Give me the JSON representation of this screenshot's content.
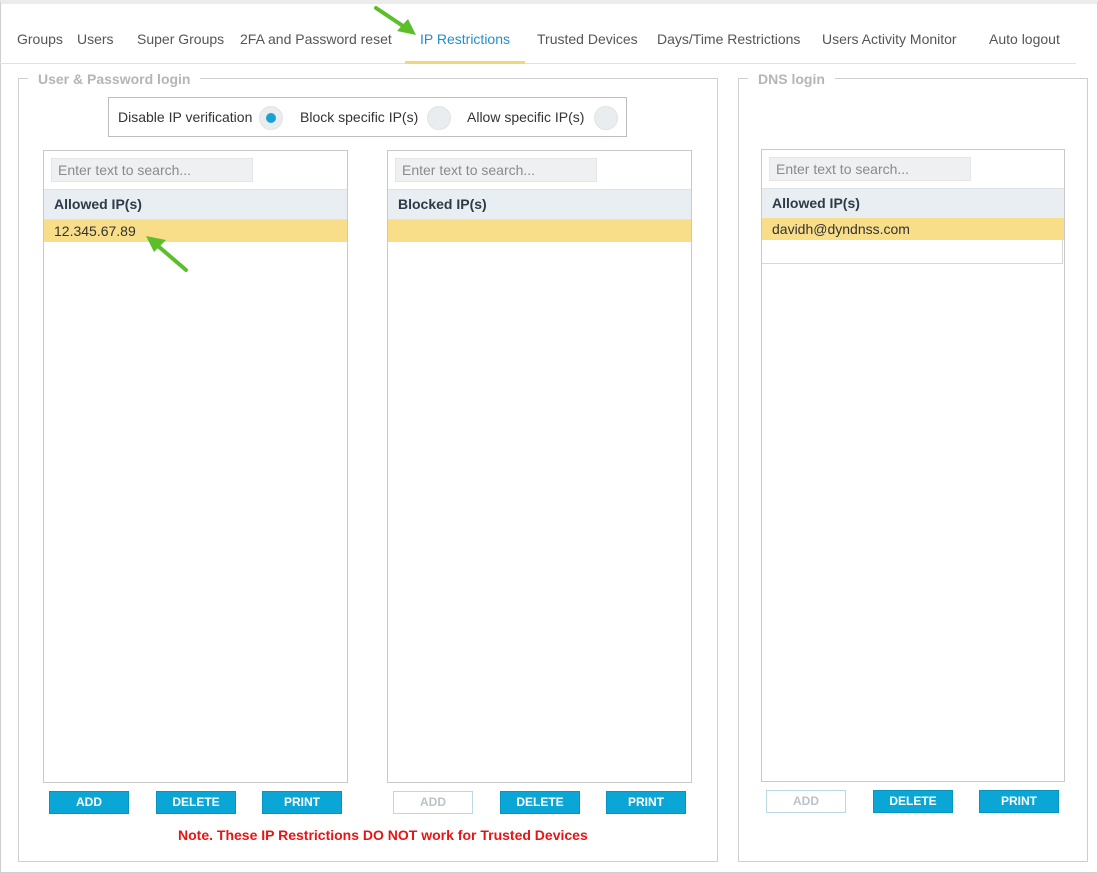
{
  "tabs": [
    {
      "label": "Groups",
      "active": false
    },
    {
      "label": "Users",
      "active": false
    },
    {
      "label": "Super Groups",
      "active": false
    },
    {
      "label": "2FA and Password reset",
      "active": false
    },
    {
      "label": "IP Restrictions",
      "active": true
    },
    {
      "label": "Trusted Devices",
      "active": false
    },
    {
      "label": "Days/Time Restrictions",
      "active": false
    },
    {
      "label": "Users Activity Monitor",
      "active": false
    },
    {
      "label": "Auto logout",
      "active": false
    }
  ],
  "user_login": {
    "legend": "User & Password login",
    "mode": {
      "options": [
        {
          "label": "Disable IP verification",
          "checked": true
        },
        {
          "label": "Block specific IP(s)",
          "checked": false
        },
        {
          "label": "Allow specific IP(s)",
          "checked": false
        }
      ]
    },
    "allowed": {
      "search_placeholder": "Enter text to search...",
      "header": "Allowed IP(s)",
      "rows": [
        "12.345.67.89"
      ],
      "buttons": {
        "add": "ADD",
        "delete": "DELETE",
        "print": "PRINT"
      }
    },
    "blocked": {
      "search_placeholder": "Enter text to search...",
      "header": "Blocked IP(s)",
      "rows": [
        ""
      ],
      "buttons": {
        "add": "ADD",
        "delete": "DELETE",
        "print": "PRINT"
      }
    },
    "note": "Note. These IP Restrictions DO NOT work for Trusted Devices"
  },
  "dns_login": {
    "legend": "DNS login",
    "allowed": {
      "search_placeholder": "Enter text to search...",
      "header": "Allowed IP(s)",
      "rows": [
        "davidh@dyndnss.com"
      ],
      "buttons": {
        "add": "ADD",
        "delete": "DELETE",
        "print": "PRINT"
      }
    }
  },
  "colors": {
    "accent": "#1d8fd0",
    "button": "#0aa6d6",
    "highlight_row": "#f8de89",
    "note": "#e81414",
    "arrow": "#5bbf2a"
  }
}
